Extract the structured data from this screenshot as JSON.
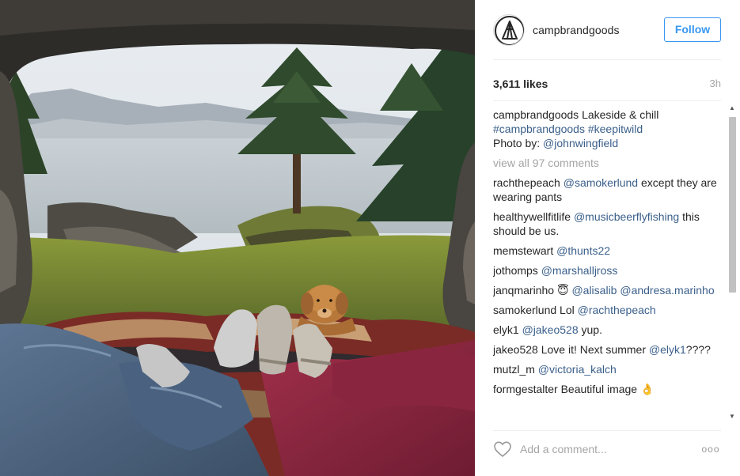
{
  "post": {
    "username": "campbrandgoods",
    "follow_label": "Follow",
    "likes": "3,611 likes",
    "time": "3h"
  },
  "caption": {
    "user": "campbrandgoods",
    "text": "Lakeside & chill",
    "hashtags": "#campbrandgoods #keepitwild",
    "credit_prefix": "Photo by:",
    "credit_user": "@johnwingfield"
  },
  "view_all": "view all 97 comments",
  "comments": [
    {
      "user": "rachthepeach",
      "mention": "@samokerlund",
      "text": "except they are wearing pants"
    },
    {
      "user": "healthywellfitlife",
      "mention": "@musicbeerflyfishing",
      "text": "this should be us."
    },
    {
      "user": "memstewart",
      "mention": "@thunts22",
      "text": ""
    },
    {
      "user": "jothomps",
      "mention": "@marshalljross",
      "text": ""
    },
    {
      "user": "janqmarinho",
      "emoji": "😇",
      "mention": "@alisalib @andresa.marinho",
      "text": ""
    },
    {
      "user": "samokerlund",
      "pre": "Lol",
      "mention": "@rachthepeach",
      "text": ""
    },
    {
      "user": "elyk1",
      "mention": "@jakeo528",
      "text": "yup."
    },
    {
      "user": "jakeo528",
      "pre": "Love it! Next summer",
      "mention": "@elyk1",
      "text": "????"
    },
    {
      "user": "mutzl_m",
      "mention": "@victoria_kalch",
      "text": ""
    },
    {
      "user": "formgestalter",
      "pre": "Beautiful image",
      "emoji": "👌",
      "mention": "",
      "text": ""
    }
  ],
  "footer": {
    "placeholder": "Add a comment...",
    "more": "ooo"
  },
  "icons": {
    "avatar": "tent-logo",
    "like": "heart-icon",
    "more": "more-options-icon"
  },
  "colors": {
    "accent": "#3897f0",
    "link": "#3a5f8a",
    "muted": "#a5a5a5"
  }
}
